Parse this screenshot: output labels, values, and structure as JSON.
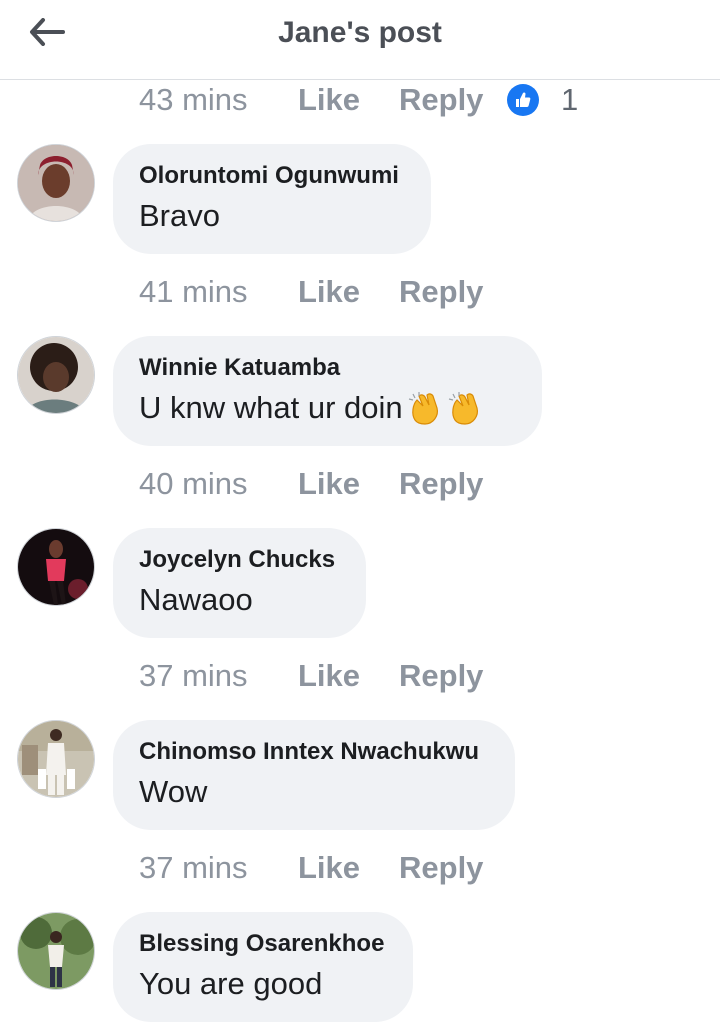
{
  "header": {
    "title": "Jane's post"
  },
  "top_meta": {
    "time": "43 mins",
    "like": "Like",
    "reply": "Reply",
    "reaction_count": "1"
  },
  "comments": [
    {
      "author": "Oloruntomi Ogunwumi",
      "text": "Bravo",
      "time": "41 mins",
      "like": "Like",
      "reply": "Reply",
      "avatar_color": "#8c1f2e"
    },
    {
      "author": "Winnie Katuamba",
      "text": "U knw what ur doin",
      "emoji": "clapping-hands x2",
      "time": "40 mins",
      "like": "Like",
      "reply": "Reply",
      "avatar_color": "#3a2a22"
    },
    {
      "author": "Joycelyn Chucks",
      "text": "Nawaoo",
      "time": "37 mins",
      "like": "Like",
      "reply": "Reply",
      "avatar_color": "#1a1012"
    },
    {
      "author": "Chinomso Inntex Nwachukwu",
      "text": "Wow",
      "time": "37 mins",
      "like": "Like",
      "reply": "Reply",
      "avatar_color": "#9a8f7a"
    },
    {
      "author": "Blessing Osarenkhoe",
      "text": "You are good",
      "avatar_color": "#4f6b3a"
    }
  ],
  "colors": {
    "accent": "#1877f2",
    "bubble": "#f0f2f5",
    "meta_text": "#8d949e"
  }
}
